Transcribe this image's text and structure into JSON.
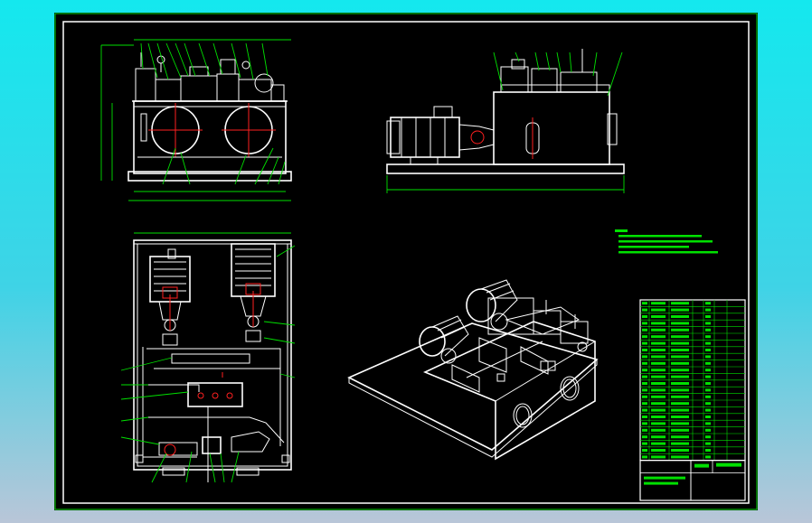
{
  "window": {
    "title": ""
  },
  "colors": {
    "background_top": "#14e8ee",
    "background_bottom": "#b9c6d8",
    "sheet": "#000000",
    "linework": "#ffffff",
    "dimensions": "#00e000",
    "centerlines": "#ff2020"
  },
  "views": [
    {
      "id": "front-elevation"
    },
    {
      "id": "side-elevation"
    },
    {
      "id": "plan-view"
    },
    {
      "id": "isometric-view"
    }
  ],
  "notes": {
    "lines_count": 4
  },
  "title_block": {
    "rows": 24
  }
}
